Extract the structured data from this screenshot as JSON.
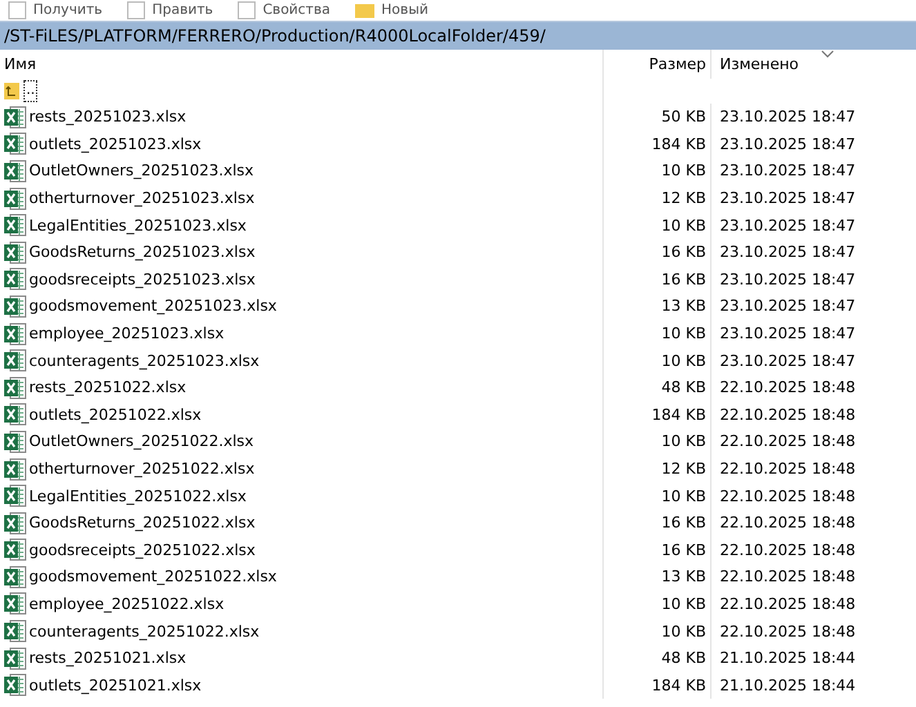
{
  "toolbar": [
    {
      "label": "Получить"
    },
    {
      "label": "Править"
    },
    {
      "label": "Свойства"
    },
    {
      "label": "Новый"
    }
  ],
  "path": "/ST-FiLES/PLATFORM/FERRERO/Production/R4000LocalFolder/459/",
  "table": {
    "columns": [
      "Имя",
      "Размер",
      "Изменено"
    ],
    "up_row": {
      "name": ".."
    },
    "rows": [
      {
        "name": "rests_20251023.xlsx",
        "size": "50 KB",
        "modified": "23.10.2025 18:47"
      },
      {
        "name": "outlets_20251023.xlsx",
        "size": "184 KB",
        "modified": "23.10.2025 18:47"
      },
      {
        "name": "OutletOwners_20251023.xlsx",
        "size": "10 KB",
        "modified": "23.10.2025 18:47"
      },
      {
        "name": "otherturnover_20251023.xlsx",
        "size": "12 KB",
        "modified": "23.10.2025 18:47"
      },
      {
        "name": "LegalEntities_20251023.xlsx",
        "size": "10 KB",
        "modified": "23.10.2025 18:47"
      },
      {
        "name": "GoodsReturns_20251023.xlsx",
        "size": "16 KB",
        "modified": "23.10.2025 18:47"
      },
      {
        "name": "goodsreceipts_20251023.xlsx",
        "size": "16 KB",
        "modified": "23.10.2025 18:47"
      },
      {
        "name": "goodsmovement_20251023.xlsx",
        "size": "13 KB",
        "modified": "23.10.2025 18:47"
      },
      {
        "name": "employee_20251023.xlsx",
        "size": "10 KB",
        "modified": "23.10.2025 18:47"
      },
      {
        "name": "counteragents_20251023.xlsx",
        "size": "10 KB",
        "modified": "23.10.2025 18:47"
      },
      {
        "name": "rests_20251022.xlsx",
        "size": "48 KB",
        "modified": "22.10.2025 18:48"
      },
      {
        "name": "outlets_20251022.xlsx",
        "size": "184 KB",
        "modified": "22.10.2025 18:48"
      },
      {
        "name": "OutletOwners_20251022.xlsx",
        "size": "10 KB",
        "modified": "22.10.2025 18:48"
      },
      {
        "name": "otherturnover_20251022.xlsx",
        "size": "12 KB",
        "modified": "22.10.2025 18:48"
      },
      {
        "name": "LegalEntities_20251022.xlsx",
        "size": "10 KB",
        "modified": "22.10.2025 18:48"
      },
      {
        "name": "GoodsReturns_20251022.xlsx",
        "size": "16 KB",
        "modified": "22.10.2025 18:48"
      },
      {
        "name": "goodsreceipts_20251022.xlsx",
        "size": "16 KB",
        "modified": "22.10.2025 18:48"
      },
      {
        "name": "goodsmovement_20251022.xlsx",
        "size": "13 KB",
        "modified": "22.10.2025 18:48"
      },
      {
        "name": "employee_20251022.xlsx",
        "size": "10 KB",
        "modified": "22.10.2025 18:48"
      },
      {
        "name": "counteragents_20251022.xlsx",
        "size": "10 KB",
        "modified": "22.10.2025 18:48"
      },
      {
        "name": "rests_20251021.xlsx",
        "size": "48 KB",
        "modified": "21.10.2025 18:44"
      },
      {
        "name": "outlets_20251021.xlsx",
        "size": "184 KB",
        "modified": "21.10.2025 18:44"
      }
    ]
  }
}
